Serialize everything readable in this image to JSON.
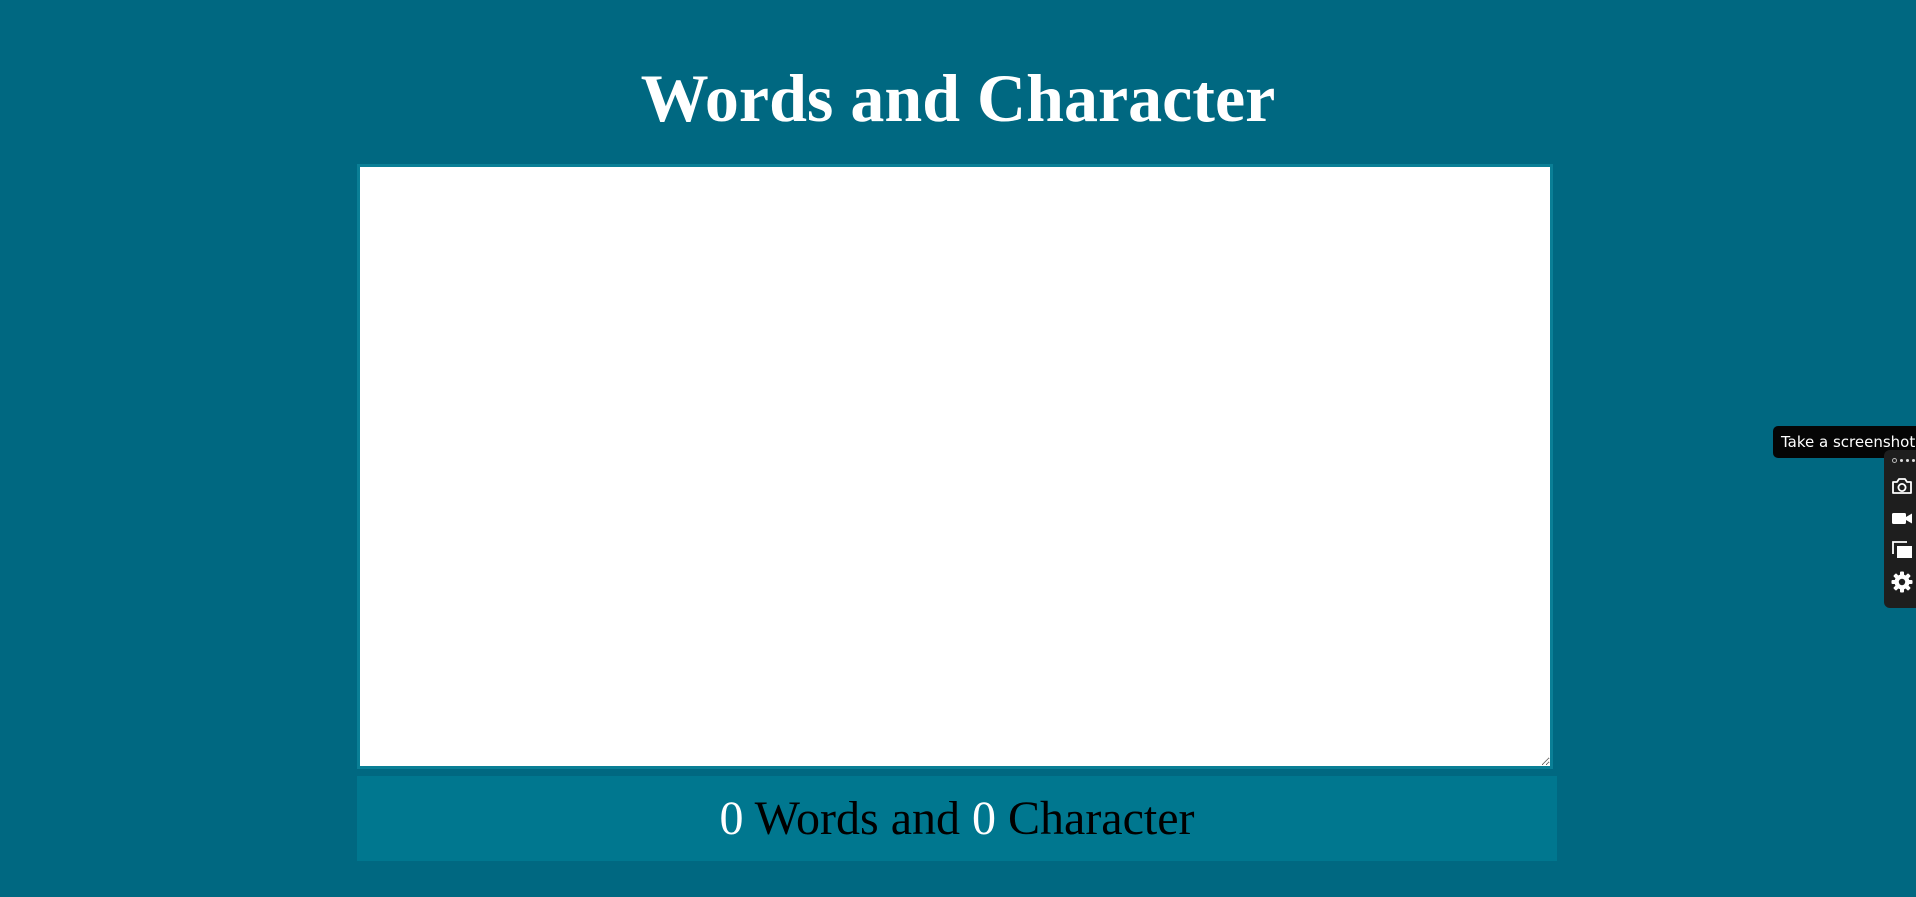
{
  "header": {
    "title": "Words and Character"
  },
  "editor": {
    "value": ""
  },
  "counter": {
    "words": "0",
    "words_label": " Words and ",
    "characters": "0",
    "characters_label": " Character"
  },
  "screenshot_tool": {
    "tooltip": "Take a screenshot",
    "buttons": [
      {
        "icon": "camera-icon"
      },
      {
        "icon": "video-icon"
      },
      {
        "icon": "window-icon"
      },
      {
        "icon": "gear-icon"
      }
    ]
  },
  "colors": {
    "background": "#006881",
    "counter_bar": "#00778f",
    "textarea_border": "#0a7f96",
    "title_text": "#ffffff"
  }
}
